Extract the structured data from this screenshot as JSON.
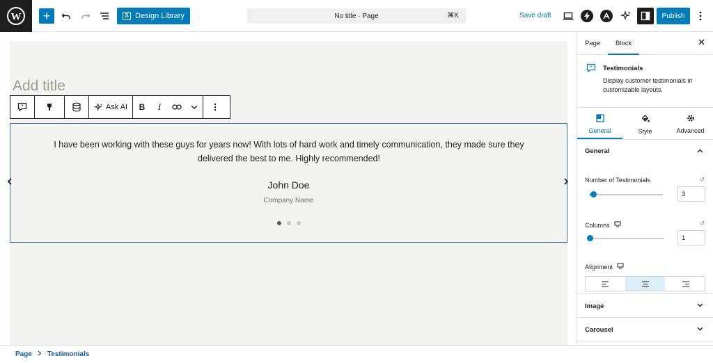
{
  "topbar": {
    "design_library_label": "Design Library",
    "document_title": "No title · Page",
    "shortcut": "⌘K",
    "save_draft_label": "Save draft",
    "publish_label": "Publish"
  },
  "canvas": {
    "title_placeholder": "Add title",
    "toolbar": {
      "ask_ai_label": "Ask AI",
      "bold_label": "B",
      "italic_label": "I"
    },
    "testimonial": {
      "quote": "I have been working with these guys for years now! With lots of hard work and timely communication, they made sure they delivered the best to me. Highly recommended!",
      "name": "John Doe",
      "company": "Company Name",
      "slides_total": 3,
      "active_slide": 1
    }
  },
  "breadcrumb": {
    "items": [
      "Page",
      "Testimonials"
    ]
  },
  "sidebar": {
    "tabs": [
      "Page",
      "Block"
    ],
    "active_tab": "Block",
    "block": {
      "title": "Testimonials",
      "description": "Display customer testimonials in customizable layouts."
    },
    "panel_tabs": [
      "General",
      "Style",
      "Advanced"
    ],
    "active_panel_tab": "General",
    "general": {
      "title": "General",
      "number_label": "Number of Testimonials",
      "number_value": "3",
      "number_fraction": 0.05,
      "columns_label": "Columns",
      "columns_value": "1",
      "columns_fraction": 0.0,
      "alignment_label": "Alignment",
      "alignment_value": "center"
    },
    "sections": [
      "Image",
      "Carousel"
    ]
  },
  "colors": {
    "accent": "#007cba",
    "dark": "#1e1e1e",
    "selected_block_border": "#3a6ea5"
  }
}
